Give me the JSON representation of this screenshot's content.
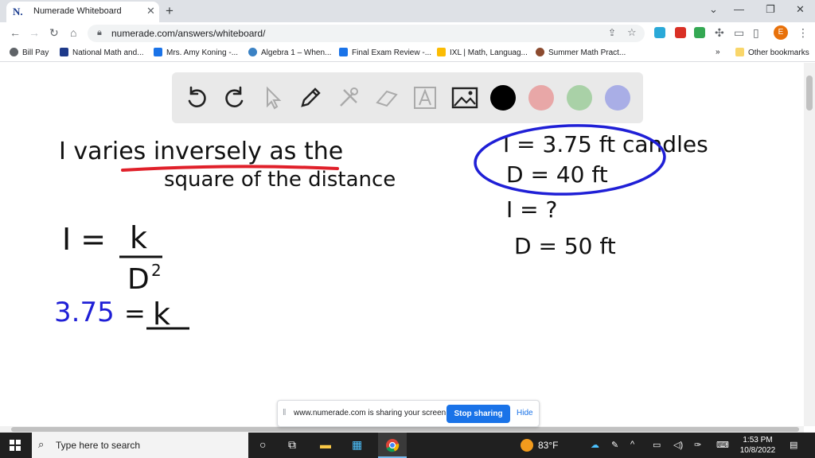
{
  "browser": {
    "tab_title": "Numerade Whiteboard",
    "tab_favicon": "N.",
    "url": "numerade.com/answers/whiteboard/",
    "profile_initial": "E"
  },
  "bookmarks": [
    {
      "label": "Bill Pay",
      "icon": "globe-icon"
    },
    {
      "label": "National Math and...",
      "icon": "ext-icon"
    },
    {
      "label": "Mrs. Amy Koning -...",
      "icon": "doc-icon"
    },
    {
      "label": "Algebra 1 – When...",
      "icon": "wordpress-icon"
    },
    {
      "label": "Final Exam Review -...",
      "icon": "doc-icon"
    },
    {
      "label": "IXL | Math, Languag...",
      "icon": "ixl-icon"
    },
    {
      "label": "Summer Math Pract...",
      "icon": "globe-icon"
    }
  ],
  "bookmarks_more": "»",
  "other_bookmarks": "Other bookmarks",
  "toolbar": {
    "tools": [
      "undo-icon",
      "redo-icon",
      "pointer-icon",
      "pen-icon",
      "tools-icon",
      "eraser-icon",
      "text-icon",
      "image-icon"
    ],
    "colors": [
      "#000000",
      "#e8a7a7",
      "#a9d1a7",
      "#a9aee6"
    ]
  },
  "board": {
    "line1": "I  varies  inversely  as  the",
    "line2": "square  of  the  distance",
    "formula_lhs": "I =",
    "formula_num": "k",
    "formula_den": "D",
    "formula_exp": "2",
    "sub_lhs": "3.75",
    "sub_eq": "=",
    "sub_num": "k",
    "given1": "I = 3.75 ft candles",
    "given2": "D = 40 ft",
    "given3": "I = ?",
    "given4": "D = 50 ft",
    "ink_color": "#111111",
    "blue_ink": "#1f1fd6",
    "red_ink": "#e0202a"
  },
  "share_banner": {
    "message": "www.numerade.com is sharing your screen.",
    "stop_label": "Stop sharing",
    "hide_label": "Hide"
  },
  "taskbar": {
    "search_placeholder": "Type here to search",
    "weather": "83°F",
    "time": "1:53 PM",
    "date": "10/8/2022"
  }
}
